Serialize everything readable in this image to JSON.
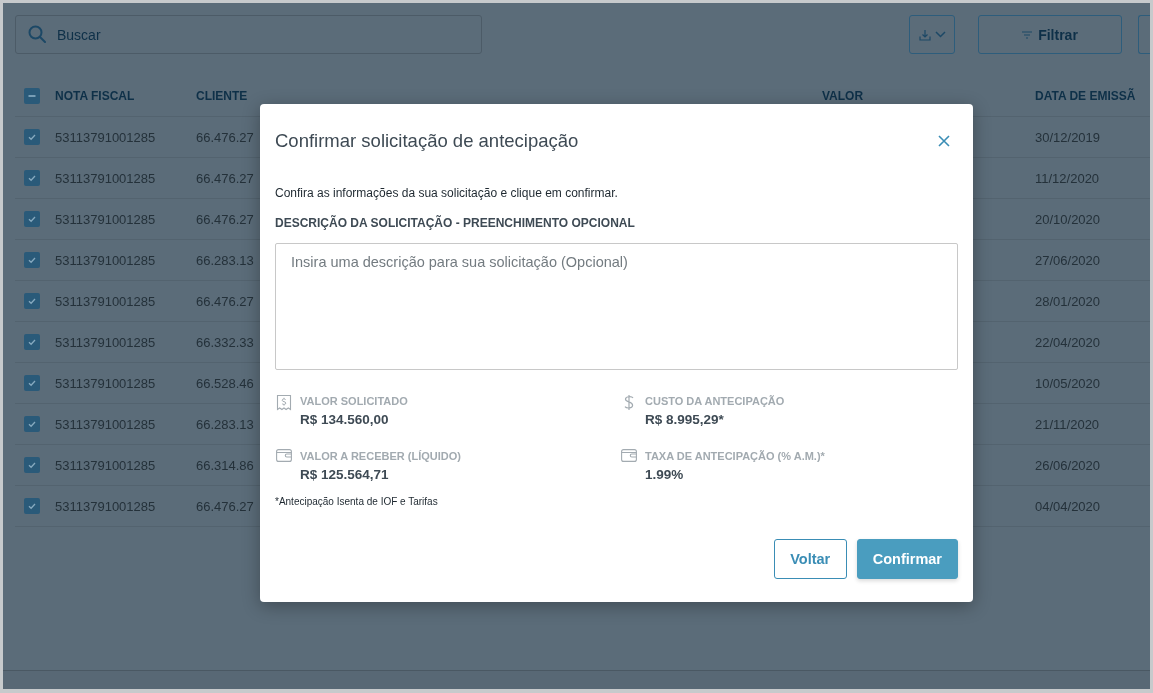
{
  "toolbar": {
    "search": {
      "placeholder": "Buscar"
    },
    "filter_button": {
      "label": "Filtrar"
    }
  },
  "table": {
    "select_all": {
      "indeterminate": true
    },
    "columns": [
      "NOTA FISCAL",
      "CLIENTE",
      "VALOR",
      "DATA DE EMISSÃ"
    ],
    "rows": [
      {
        "checked": true,
        "nota_fiscal": "53113791001285",
        "cliente": "66.476.27",
        "data_emissao": "30/12/2019"
      },
      {
        "checked": true,
        "nota_fiscal": "53113791001285",
        "cliente": "66.476.27",
        "data_emissao": "11/12/2020"
      },
      {
        "checked": true,
        "nota_fiscal": "53113791001285",
        "cliente": "66.476.27",
        "data_emissao": "20/10/2020"
      },
      {
        "checked": true,
        "nota_fiscal": "53113791001285",
        "cliente": "66.283.13",
        "data_emissao": "27/06/2020"
      },
      {
        "checked": true,
        "nota_fiscal": "53113791001285",
        "cliente": "66.476.27",
        "data_emissao": "28/01/2020"
      },
      {
        "checked": true,
        "nota_fiscal": "53113791001285",
        "cliente": "66.332.33",
        "data_emissao": "22/04/2020"
      },
      {
        "checked": true,
        "nota_fiscal": "53113791001285",
        "cliente": "66.528.46",
        "data_emissao": "10/05/2020"
      },
      {
        "checked": true,
        "nota_fiscal": "53113791001285",
        "cliente": "66.283.13",
        "data_emissao": "21/11/2020"
      },
      {
        "checked": true,
        "nota_fiscal": "53113791001285",
        "cliente": "66.314.86",
        "data_emissao": "26/06/2020"
      },
      {
        "checked": true,
        "nota_fiscal": "53113791001285",
        "cliente": "66.476.27",
        "data_emissao": "04/04/2020"
      }
    ]
  },
  "dialog": {
    "title": "Confirmar solicitação de antecipação",
    "intro": "Confira as informações da sua solicitação e clique em confirmar.",
    "description_label": "DESCRIÇÃO DA SOLICITAÇÃO - PREENCHIMENTO OPCIONAL",
    "description": {
      "placeholder": "Insira uma descrição para sua solicitação (Opcional)"
    },
    "summary": [
      {
        "label": "VALOR SOLICITADO",
        "value": "R$ 134.560,00"
      },
      {
        "label": "CUSTO DA ANTECIPAÇÃO",
        "value": "R$ 8.995,29*"
      },
      {
        "label": "VALOR A RECEBER (LÍQUIDO)",
        "value": "R$ 125.564,71"
      },
      {
        "label": "TAXA DE ANTECIPAÇÃO (% A.M.)*",
        "value": "1.99%"
      }
    ],
    "footnote": "*Antecipação Isenta de IOF e Tarifas",
    "buttons": [
      {
        "label": "Voltar",
        "kind": "secondary"
      },
      {
        "label": "Confirmar",
        "kind": "primary"
      }
    ]
  }
}
